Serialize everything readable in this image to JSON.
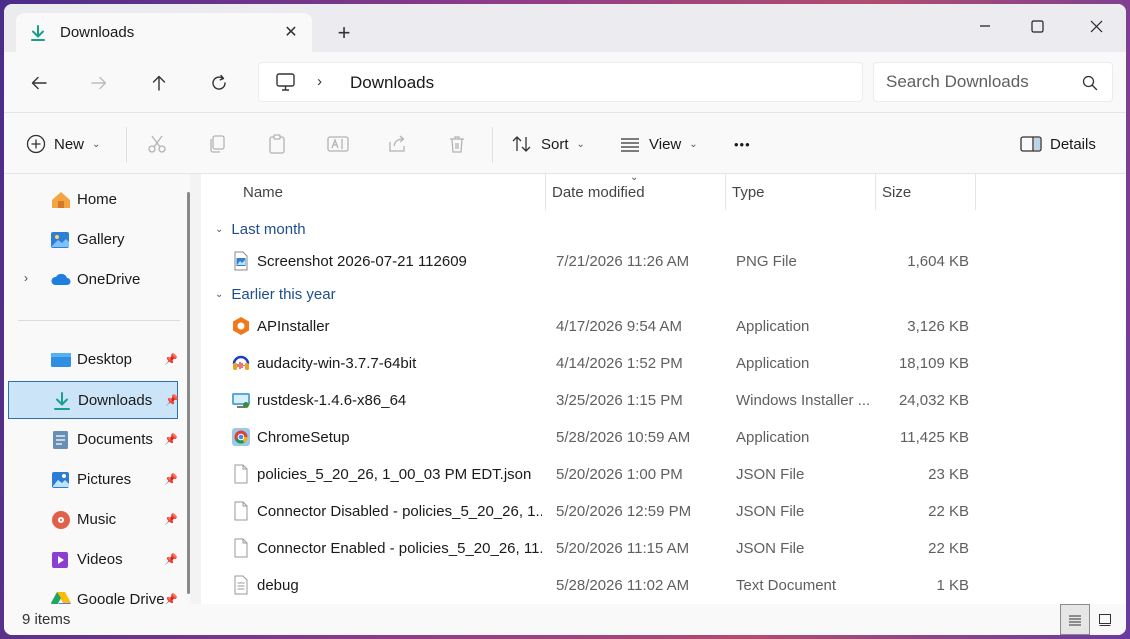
{
  "tab": {
    "title": "Downloads"
  },
  "address": {
    "crumb": "Downloads",
    "separator": "›"
  },
  "search": {
    "placeholder": "Search Downloads"
  },
  "toolbar": {
    "new_label": "New",
    "sort_label": "Sort",
    "view_label": "View",
    "more_label": "•••",
    "details_label": "Details"
  },
  "sidebar": {
    "items": [
      {
        "label": "Home",
        "icon": "home-icon"
      },
      {
        "label": "Gallery",
        "icon": "gallery-icon"
      },
      {
        "label": "OneDrive",
        "icon": "onedrive-icon"
      },
      {
        "label": "Desktop",
        "icon": "desktop-folder-icon"
      },
      {
        "label": "Downloads",
        "icon": "downloads-folder-icon",
        "selected": true
      },
      {
        "label": "Documents",
        "icon": "documents-folder-icon"
      },
      {
        "label": "Pictures",
        "icon": "pictures-folder-icon"
      },
      {
        "label": "Music",
        "icon": "music-folder-icon"
      },
      {
        "label": "Videos",
        "icon": "videos-folder-icon"
      },
      {
        "label": "Google Drive",
        "icon": "google-drive-icon"
      }
    ]
  },
  "columns": {
    "name": "Name",
    "date": "Date modified",
    "type": "Type",
    "size": "Size"
  },
  "groups": [
    {
      "label": "Last month",
      "files": [
        {
          "name": "Screenshot 2026-07-21 112609",
          "date": "7/21/2026 11:26 AM",
          "type": "PNG File",
          "size": "1,604 KB",
          "icon": "png-file-icon"
        }
      ]
    },
    {
      "label": "Earlier this year",
      "files": [
        {
          "name": "APInstaller",
          "date": "4/17/2026 9:54 AM",
          "type": "Application",
          "size": "3,126 KB",
          "icon": "apinstaller-icon"
        },
        {
          "name": "audacity-win-3.7.7-64bit",
          "date": "4/14/2026 1:52 PM",
          "type": "Application",
          "size": "18,109 KB",
          "icon": "audacity-icon"
        },
        {
          "name": "rustdesk-1.4.6-x86_64",
          "date": "3/25/2026 1:15 PM",
          "type": "Windows Installer ...",
          "size": "24,032 KB",
          "icon": "msi-installer-icon"
        },
        {
          "name": "ChromeSetup",
          "date": "5/28/2026 10:59 AM",
          "type": "Application",
          "size": "11,425 KB",
          "icon": "chrome-setup-icon"
        },
        {
          "name": "policies_5_20_26, 1_00_03 PM EDT.json",
          "date": "5/20/2026 1:00 PM",
          "type": "JSON File",
          "size": "23 KB",
          "icon": "json-file-icon"
        },
        {
          "name": "Connector Disabled - policies_5_20_26, 1...",
          "date": "5/20/2026 12:59 PM",
          "type": "JSON File",
          "size": "22 KB",
          "icon": "json-file-icon"
        },
        {
          "name": "Connector Enabled - policies_5_20_26, 11...",
          "date": "5/20/2026 11:15 AM",
          "type": "JSON File",
          "size": "22 KB",
          "icon": "json-file-icon"
        },
        {
          "name": "debug",
          "date": "5/28/2026 11:02 AM",
          "type": "Text Document",
          "size": "1 KB",
          "icon": "text-file-icon"
        }
      ]
    }
  ],
  "status": {
    "count": "9 items"
  },
  "colors": {
    "accent": "#0067c0",
    "selected_bg": "#cce4f7",
    "group_header": "#1f4e8c"
  }
}
